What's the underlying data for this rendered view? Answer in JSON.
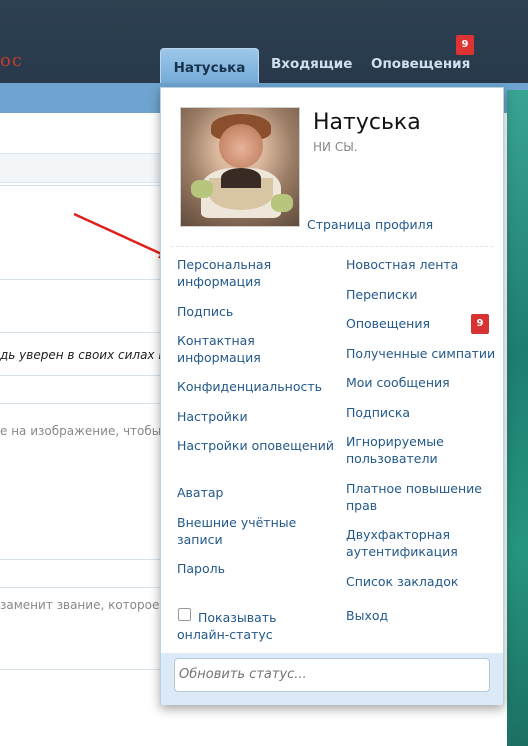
{
  "header": {
    "logo_fragment": "ос",
    "tabs": {
      "user": "Натуська",
      "inbox": "Входящие",
      "alerts": "Оповещения"
    },
    "alerts_count": "9"
  },
  "background": {
    "text1": "дь уверен в своих силах и",
    "text2": "е на изображение, чтобы",
    "text3": "заменит звание, которое о"
  },
  "popup": {
    "username": "Натуська",
    "user_title": "НИ СЫ.",
    "profile_link": "Страница профиля",
    "left_menu": [
      "Персональная информация",
      "Подпись",
      "Контактная информация",
      "Конфиденциальность",
      "Настройки",
      "Настройки оповещений",
      "Аватар",
      "Внешние учётные записи",
      "Пароль"
    ],
    "right_menu": [
      "Новостная лента",
      "Переписки",
      "Оповещения",
      "Полученные симпатии",
      "Мои сообщения",
      "Подписка",
      "Игнорируемые пользователи",
      "Платное повышение прав",
      "Двухфакторная аутентификация",
      "Список закладок",
      "Выход"
    ],
    "alerts_badge": "9",
    "show_online": "Показывать онлайн-статус",
    "status_placeholder": "Обновить статус..."
  },
  "colors": {
    "header_bg": "#2d4051",
    "link": "#23598a",
    "badge": "#dd3333",
    "navbar": "#6ea4cf"
  }
}
